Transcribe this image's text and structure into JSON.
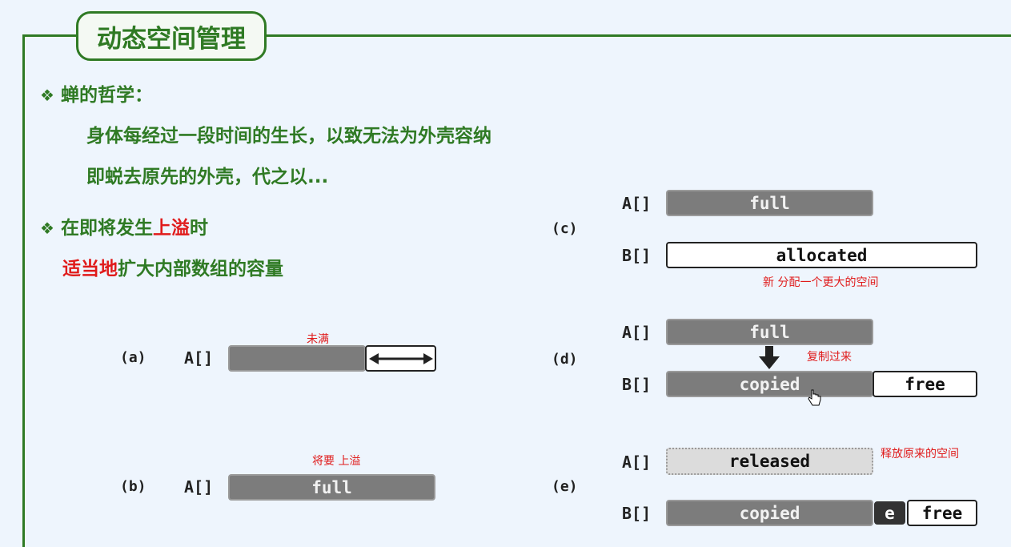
{
  "title": "动态空间管理",
  "bullets": {
    "b1_label": "蝉的哲学：",
    "b1_line1": "身体每经过一段时间的生长，以致无法为外壳容纳",
    "b1_line2": "即蜕去原先的外壳，代之以...",
    "b2_pre": "在即将发生",
    "b2_red": "上溢",
    "b2_post": "时",
    "b3_red": "适当地",
    "b3_post": "扩大内部数组的容量",
    "bullet_glyph": "❖"
  },
  "diagram": {
    "a": {
      "label": "(a)",
      "array": "A[]",
      "note": "未满"
    },
    "b": {
      "label": "(b)",
      "array": "A[]",
      "bar": "full",
      "note": "将要 上溢"
    },
    "c": {
      "label": "(c)",
      "a_array": "A[]",
      "a_bar": "full",
      "b_array": "B[]",
      "b_bar": "allocated",
      "note": "新 分配一个更大的空间"
    },
    "d": {
      "label": "(d)",
      "a_array": "A[]",
      "a_bar": "full",
      "b_array": "B[]",
      "b_bar": "copied",
      "b_free": "free",
      "note": "复制过来"
    },
    "e": {
      "label": "(e)",
      "a_array": "A[]",
      "a_bar": "released",
      "b_array": "B[]",
      "b_bar": "copied",
      "b_new": "e",
      "b_free": "free",
      "note": "释放原来的空间"
    }
  },
  "colors": {
    "green": "#2f7a24",
    "red": "#e01b1b",
    "bar_gray": "#7c7c7c",
    "background": "#eef5fd"
  }
}
